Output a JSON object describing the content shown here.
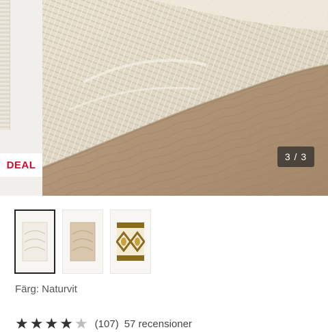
{
  "gallery": {
    "deal_label": "DEAL",
    "counter": "3 / 3",
    "current_index": 3,
    "total": 3
  },
  "thumbnails": [
    {
      "name": "natural-white-rug",
      "selected": true
    },
    {
      "name": "beige-rug",
      "selected": false
    },
    {
      "name": "mustard-patterned-rug",
      "selected": false
    }
  ],
  "product": {
    "color_text": "Färg: Naturvit"
  },
  "rating": {
    "stars": 4,
    "max_stars": 5,
    "count_text": "(107)",
    "reviews_text": "57 recensioner"
  },
  "colors": {
    "deal_red": "#c8102e",
    "counter_bg": "#3a3a3a",
    "floor_wood": "#b49a7b",
    "rug_cream": "#e9e2d2"
  }
}
